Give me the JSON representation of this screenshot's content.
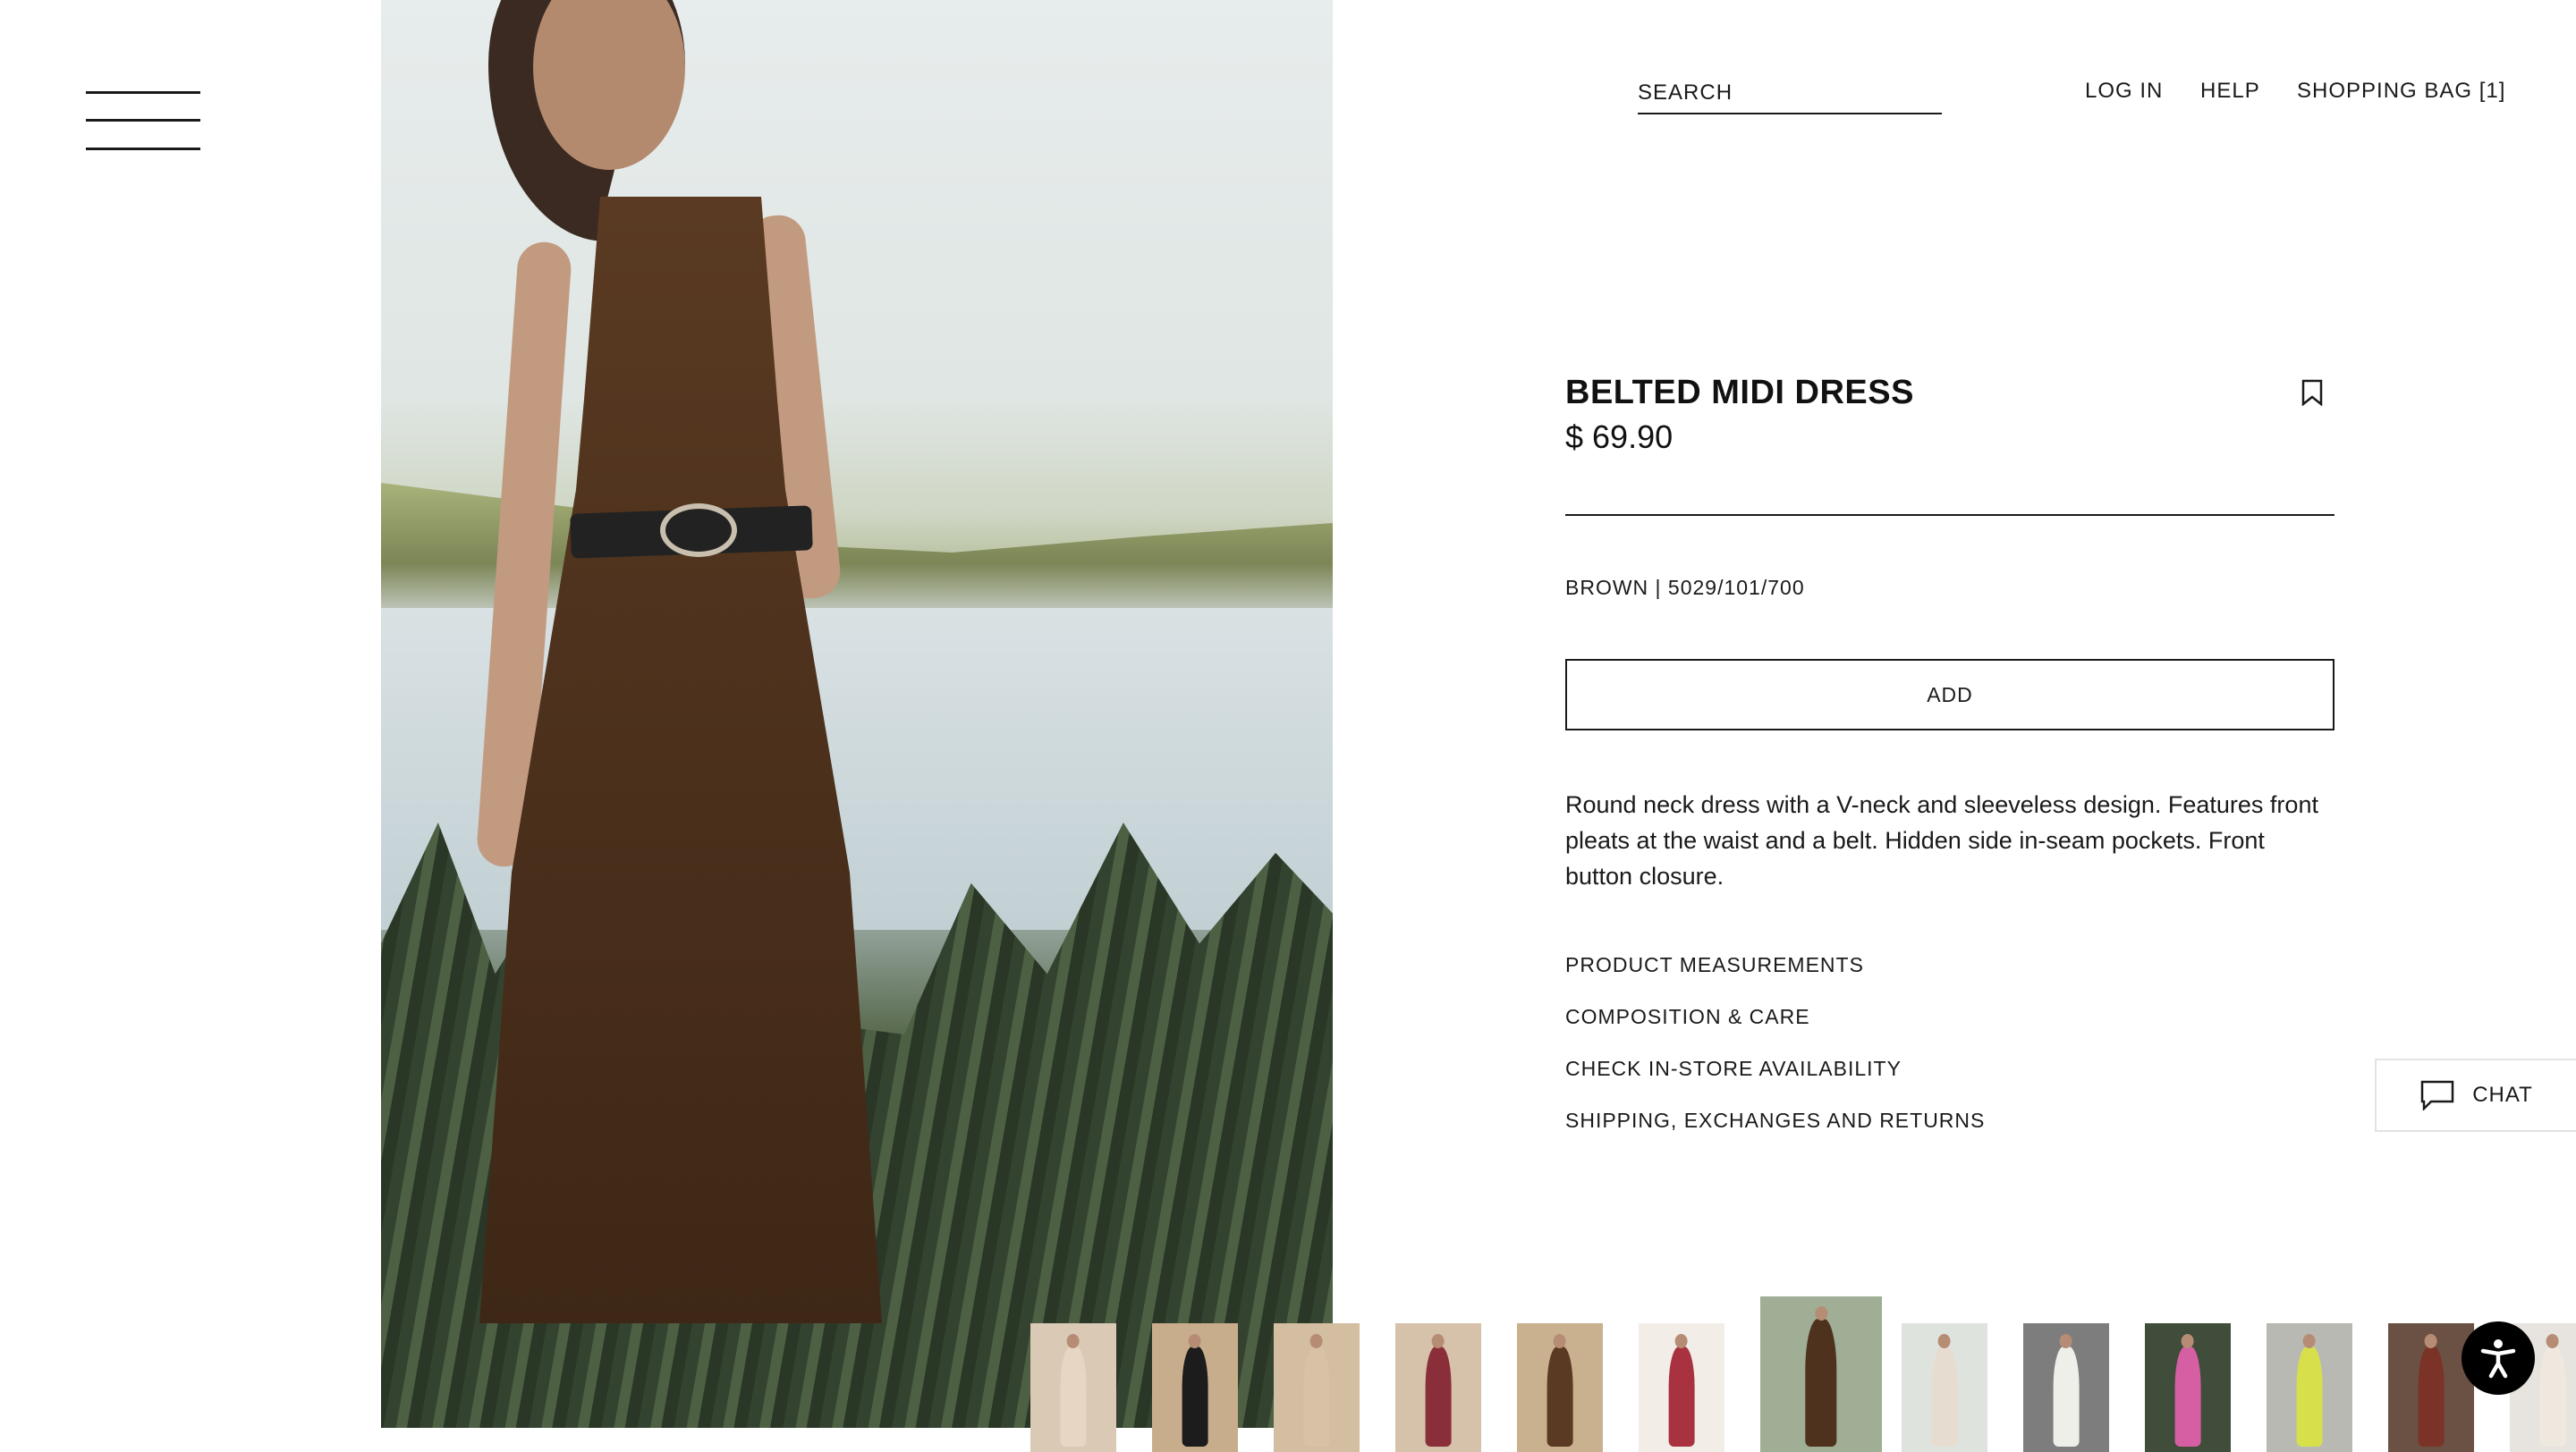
{
  "header": {
    "search_placeholder": "SEARCH",
    "nav": {
      "login": "LOG IN",
      "help": "HELP",
      "bag": "SHOPPING BAG [1]"
    }
  },
  "product": {
    "title": "BELTED MIDI DRESS",
    "price": "$ 69.90",
    "color_ref": "BROWN | 5029/101/700",
    "add_label": "ADD",
    "description": "Round neck dress with a V-neck and sleeveless design. Features front pleats at the waist and a belt. Hidden side in-seam pockets. Front button closure.",
    "links": [
      "PRODUCT MEASUREMENTS",
      "COMPOSITION & CARE",
      "CHECK IN-STORE AVAILABILITY",
      "SHIPPING, EXCHANGES AND RETURNS"
    ]
  },
  "chat": {
    "label": "CHAT"
  },
  "icons": {
    "menu": "hamburger-menu-icon",
    "bookmark": "bookmark-icon",
    "chat": "chat-bubble-icon",
    "accessibility": "accessibility-icon"
  },
  "thumbnails": [
    {
      "bg": "#d9c9b5",
      "garment": "#e8d6c4"
    },
    {
      "bg": "#c8ad8d",
      "garment": "#1c1c1c"
    },
    {
      "bg": "#d3bea2",
      "garment": "#d8c2a5"
    },
    {
      "bg": "#d6c2aa",
      "garment": "#8a2f3a"
    },
    {
      "bg": "#c9b08f",
      "garment": "#5a3a22"
    },
    {
      "bg": "#f2ede6",
      "garment": "#a8323f"
    },
    {
      "bg": "#9fae94",
      "garment": "#4e321d",
      "active": true
    },
    {
      "bg": "#dfe3dd",
      "garment": "#e6ddd0"
    },
    {
      "bg": "#7d7d7d",
      "garment": "#efefea"
    },
    {
      "bg": "#3f4d3a",
      "garment": "#d65fa4"
    },
    {
      "bg": "#b9b9b4",
      "garment": "#d7e04a"
    },
    {
      "bg": "#6b5143",
      "garment": "#7a3326"
    },
    {
      "bg": "#e7e4df",
      "garment": "#efe8df"
    }
  ],
  "colors": {
    "text": "#1a1a1a",
    "accent": "#000000"
  }
}
